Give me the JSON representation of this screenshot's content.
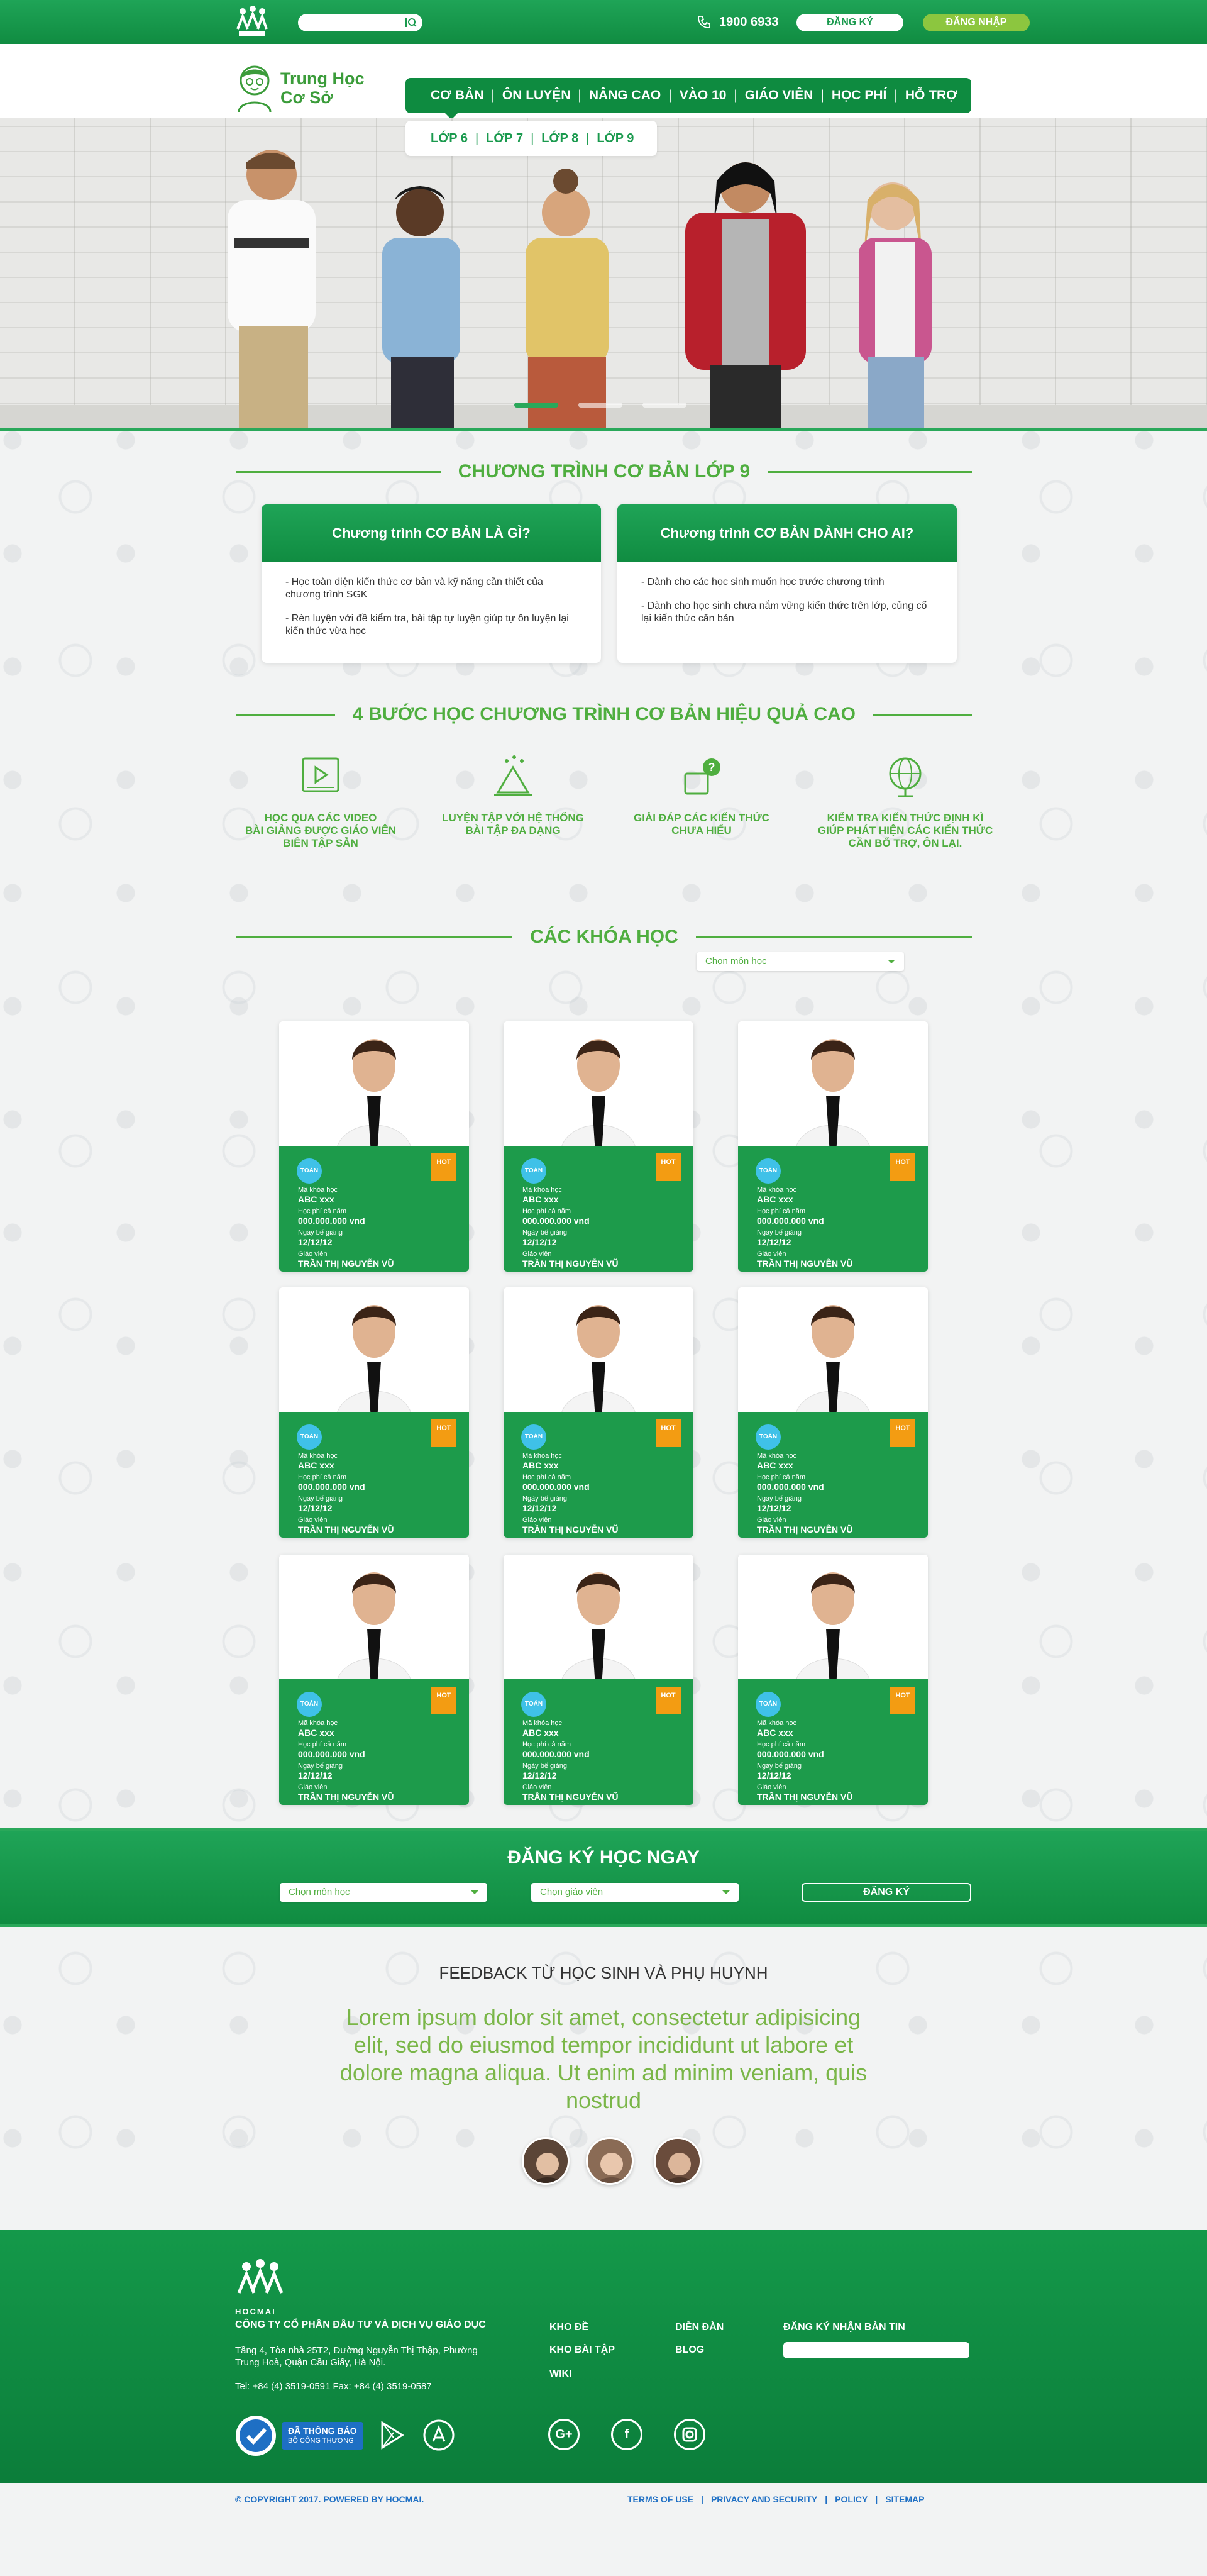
{
  "topbar": {
    "search_placeholder": "",
    "phone": "1900 6933",
    "register_label": "ĐĂNG KÝ",
    "login_label": "ĐĂNG NHẬP"
  },
  "header": {
    "brand_line1": "Trung Học",
    "brand_line2": "Cơ Sở",
    "nav": [
      "CƠ BẢN",
      "ÔN LUYỆN",
      "NÂNG CAO",
      "VÀO 10",
      "GIÁO VIÊN",
      "HỌC PHÍ",
      "HỖ TRỢ"
    ],
    "subnav": [
      "LỚP 6",
      "LỚP 7",
      "LỚP 8",
      "LỚP 9"
    ]
  },
  "section1": {
    "title": "CHƯƠNG TRÌNH CƠ BẢN LỚP 9",
    "card_left": {
      "title": "Chương trình CƠ BẢN LÀ GÌ?",
      "p1": "- Học toàn diện kiến thức cơ bản và kỹ năng cần thiết của chương trình SGK",
      "p2": "- Rèn luyện với đề kiểm tra, bài tập tự luyện giúp tự ôn luyện lại kiến thức vừa học"
    },
    "card_right": {
      "title": "Chương trình CƠ BẢN DÀNH CHO AI?",
      "p1": "- Dành cho các học sinh muốn học trước chương trình",
      "p2": "- Dành cho học sinh chưa nắm vững kiến thức trên lớp, củng cố lại kiến thức căn bản"
    }
  },
  "section2": {
    "title": "4 BƯỚC HỌC CHƯƠNG TRÌNH CƠ BẢN HIỆU QUẢ CAO",
    "steps": [
      {
        "line1": "HỌC QUA CÁC VIDEO",
        "line2": "BÀI GIẢNG ĐƯỢC GIÁO VIÊN",
        "line3": "BIÊN TẬP SẴN"
      },
      {
        "line1": "LUYỆN TẬP VỚI HỆ THỐNG",
        "line2": "BÀI TẬP ĐA DẠNG",
        "line3": ""
      },
      {
        "line1": "GIẢI ĐÁP CÁC KIẾN THỨC",
        "line2": "CHƯA HIỂU",
        "line3": ""
      },
      {
        "line1": "KIỂM TRA KIẾN THỨC ĐỊNH KÌ",
        "line2": "GIÚP PHÁT HIỆN CÁC KIẾN THỨC",
        "line3": "CẦN BỔ TRỢ, ÔN LẠI."
      }
    ]
  },
  "section3": {
    "title": "CÁC KHÓA HỌC",
    "select_subject": "Chọn môn học",
    "course": {
      "subject_badge": "TOÁN",
      "hot_badge": "HOT",
      "code_label": "Mã khóa học",
      "code_value": "ABC xxx",
      "fee_label": "Học phí cả năm",
      "fee_value": "000.000.000 vnd",
      "date_label": "Ngày bế giảng",
      "date_value": "12/12/12",
      "teacher_label": "Giáo viên",
      "teacher_value": "TRẦN THỊ NGUYỄN VŨ"
    }
  },
  "register": {
    "title": "ĐĂNG KÝ HỌC NGAY",
    "select_subject": "Chọn môn học",
    "select_teacher": "Chọn giáo viên",
    "button": "ĐĂNG KÝ"
  },
  "feedback": {
    "title": "FEEDBACK TỪ HỌC SINH VÀ PHỤ HUYNH",
    "quote": "Lorem ipsum dolor sit amet, consectetur adipisicing elit, sed do eiusmod tempor incididunt ut labore et dolore magna aliqua. Ut enim ad minim veniam, quis nostrud"
  },
  "footer": {
    "company": "CÔNG TY CỔ PHẦN ĐẦU TƯ VÀ DỊCH VỤ GIÁO DỤC",
    "address": "Tầng 4, Tòa nhà 25T2, Đường Nguyễn Thị Thập, Phường Trung Hoà, Quận Cầu Giấy, Hà Nội.",
    "tel": "Tel: +84 (4) 3519-0591  Fax: +84 (4) 3519-0587",
    "links_col1": [
      "KHO ĐỀ",
      "KHO BÀI TẬP",
      "WIKI"
    ],
    "links_col2": [
      "DIỄN ĐÀN",
      "BLOG"
    ],
    "newsletter_label": "ĐĂNG KÝ NHẬN BẢN TIN",
    "cert_line1": "ĐÃ THÔNG BÁO",
    "cert_line2": "BỘ CÔNG THƯƠNG",
    "copyright": "© COPYRIGHT 2017. POWERED BY HOCMAI.",
    "bottom_links": [
      "TERMS OF USE",
      "PRIVACY AND SECURITY",
      "POLICY",
      "SITEMAP"
    ],
    "logo_text": "HOCMAI"
  },
  "colors": {
    "primary_green": "#108c41",
    "accent_green": "#4fae3f",
    "light_green": "#8cc63f",
    "link_blue": "#1e6fc4",
    "hot_orange": "#f39c12",
    "subject_blue": "#3fc1e8"
  }
}
